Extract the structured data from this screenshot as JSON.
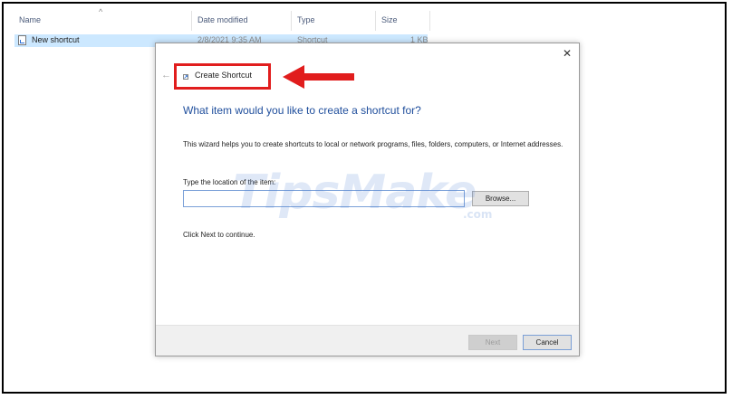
{
  "explorer": {
    "columns": [
      "Name",
      "Date modified",
      "Type",
      "Size"
    ],
    "row": {
      "name": "New shortcut",
      "date": "2/8/2021 9:35 AM",
      "type": "Shortcut",
      "size": "1 KB"
    }
  },
  "dialog": {
    "title": "Create Shortcut",
    "heading": "What item would you like to create a shortcut for?",
    "description": "This wizard helps you to create shortcuts to local or network programs, files, folders, computers, or Internet addresses.",
    "field_label": "Type the location of the item:",
    "location_value": "",
    "browse_label": "Browse...",
    "continue_text": "Click Next to continue.",
    "next_label": "Next",
    "cancel_label": "Cancel",
    "close_glyph": "✕",
    "back_glyph": "←"
  },
  "watermark": {
    "text": "TipsMake",
    "suffix": ".com"
  },
  "colors": {
    "heading": "#1f4e9c",
    "highlight": "#e11d1d",
    "selection": "#cce8ff"
  }
}
